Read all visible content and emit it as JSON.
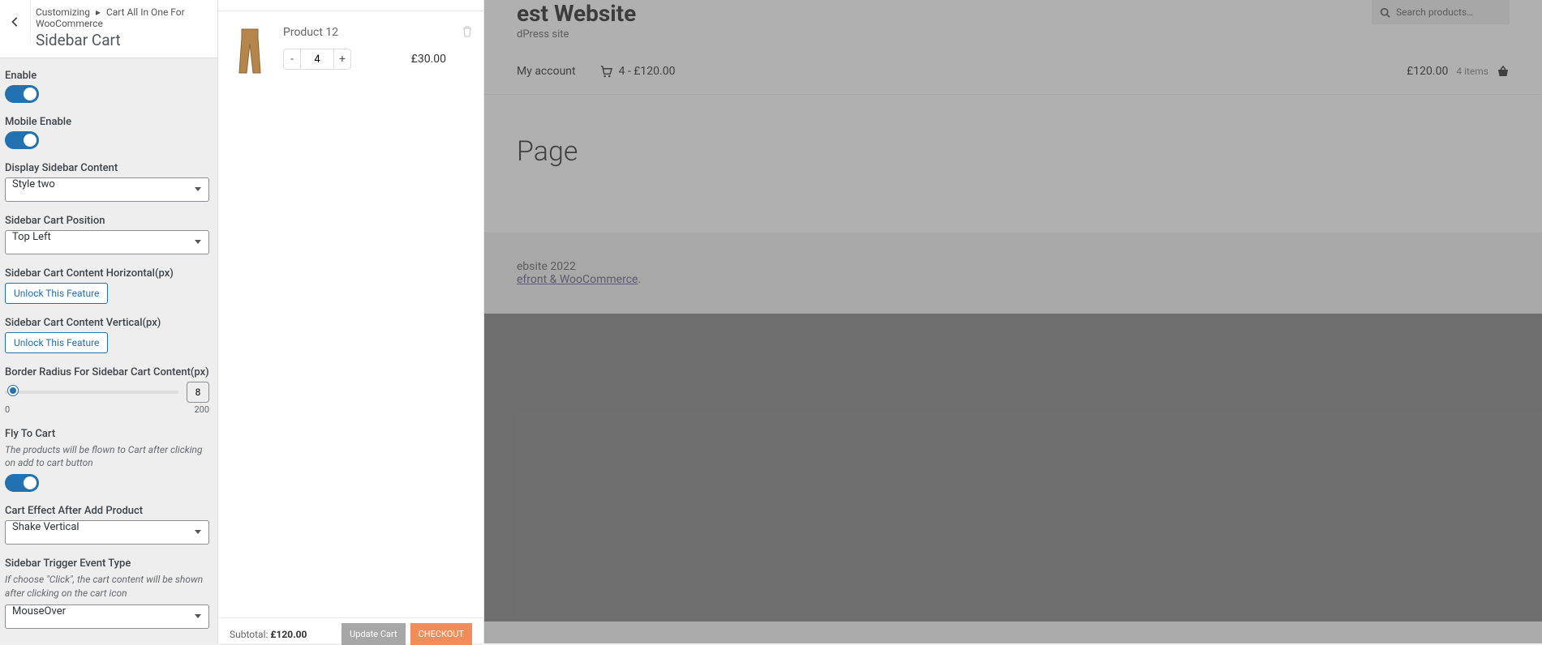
{
  "customizer": {
    "crumb_a": "Customizing",
    "crumb_b": "Cart All In One For WooCommerce",
    "title": "Sidebar Cart",
    "enable_label": "Enable",
    "mobile_enable_label": "Mobile Enable",
    "display_content_label": "Display Sidebar Content",
    "display_content_value": "Style two",
    "position_label": "Sidebar Cart Position",
    "position_value": "Top Left",
    "horiz_label": "Sidebar Cart Content Horizontal(px)",
    "vert_label": "Sidebar Cart Content Vertical(px)",
    "unlock_text": "Unlock This Feature",
    "radius_label": "Border Radius For Sidebar Cart Content(px)",
    "radius_value": "8",
    "radius_min": "0",
    "radius_max": "200",
    "fly_label": "Fly To Cart",
    "fly_desc": "The products will be flown to Cart after clicking on add to cart button",
    "effect_label": "Cart Effect After Add Product",
    "effect_value": "Shake Vertical",
    "trigger_label": "Sidebar Trigger Event Type",
    "trigger_desc": "If choose \"Click\", the cart content will be shown after clicking on the cart icon",
    "trigger_value": "MouseOver"
  },
  "cart": {
    "item_title": "Product 12",
    "item_qty": "4",
    "item_price": "£30.00",
    "subtotal_label": "Subtotal:",
    "subtotal_value": "£120.00",
    "update_label": "Update Cart",
    "checkout_label": "CHECKOUT"
  },
  "site": {
    "title_fragment": "est Website",
    "tagline_fragment": "dPress site",
    "search_placeholder": "Search products…",
    "nav_account": "My account",
    "nav_cart_text": "4 - £120.00",
    "nav_total": "£120.00",
    "nav_items": "4 items",
    "page_title_fragment": "Page",
    "footer_line1_fragment": "ebsite 2022",
    "footer_link_fragment": "efront & WooCommerce"
  }
}
